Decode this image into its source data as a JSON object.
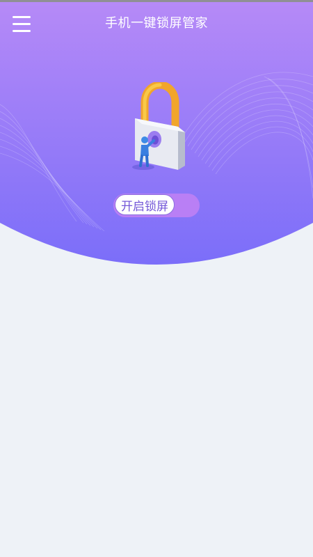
{
  "header": {
    "title": "手机一键锁屏管家",
    "menu_icon": "hamburger-menu-icon"
  },
  "hero": {
    "illustration_icon": "padlock-with-person-icon",
    "gradient_top": "#b68af7",
    "gradient_bottom": "#7b6ef9"
  },
  "lock_toggle": {
    "label": "开启锁屏",
    "state": "off",
    "track_color": "#b97ff5",
    "knob_color": "#ffffff"
  },
  "theme": {
    "page_background": "#eef2f7",
    "accent": "#7458d8"
  }
}
